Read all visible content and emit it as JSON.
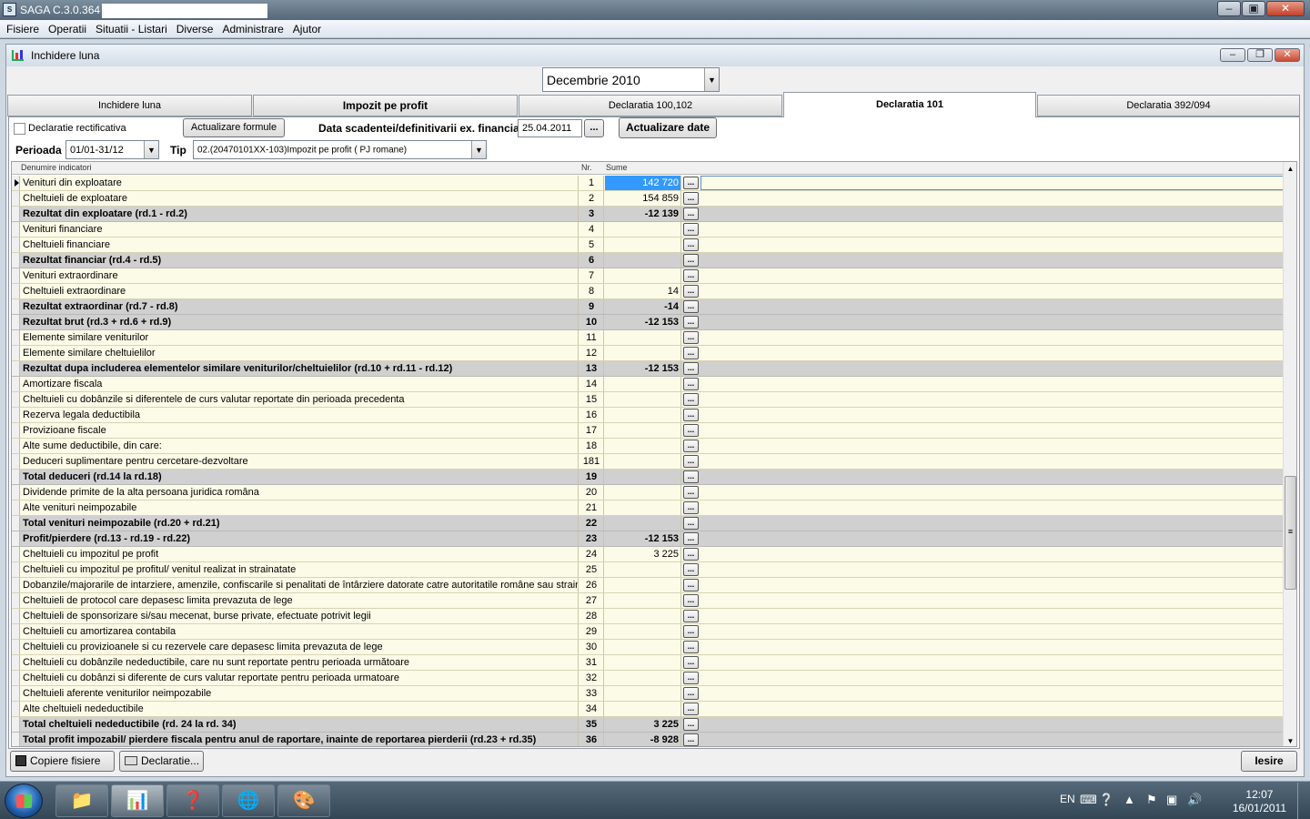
{
  "app": {
    "title": "SAGA C.3.0.364"
  },
  "menu": [
    "Fisiere",
    "Operatii",
    "Situatii - Listari",
    "Diverse",
    "Administrare",
    "Ajutor"
  ],
  "window": {
    "title": "Inchidere luna"
  },
  "period_combo": {
    "value": "Decembrie  2010"
  },
  "tabs": [
    "Inchidere luna",
    "Impozit pe profit",
    "Declaratia 100,102",
    "Declaratia 101",
    "Declaratia 392/094"
  ],
  "form": {
    "rectificativa_label": "Declaratie rectificativa",
    "rectificativa_checked": false,
    "actualizare_formule": "Actualizare formule",
    "data_scadentei_label": "Data scadentei/definitivarii ex. financiar",
    "data_scadentei_value": "25.04.2011",
    "browse_label": "...",
    "actualizare_date": "Actualizare date",
    "perioada_label": "Perioada",
    "perioada_value": "01/01-31/12",
    "tip_label": "Tip",
    "tip_value": "02.(20470101XX-103)Impozit pe profit ( PJ romane)"
  },
  "grid": {
    "headers": {
      "name": "Denumire indicatori",
      "nr": "Nr.",
      "sum": "Sume"
    },
    "rows": [
      {
        "name": "Venituri din exploatare",
        "nr": "1",
        "sum": "142 720",
        "bold": false,
        "selected": true
      },
      {
        "name": "Cheltuieli de exploatare",
        "nr": "2",
        "sum": "154 859",
        "bold": false
      },
      {
        "name": "Rezultat din exploatare (rd.1 - rd.2)",
        "nr": "3",
        "sum": "-12 139",
        "bold": true
      },
      {
        "name": "Venituri financiare",
        "nr": "4",
        "sum": "",
        "bold": false
      },
      {
        "name": "Cheltuieli financiare",
        "nr": "5",
        "sum": "",
        "bold": false
      },
      {
        "name": "Rezultat  financiar (rd.4 - rd.5)",
        "nr": "6",
        "sum": "",
        "bold": true
      },
      {
        "name": "Venituri extraordinare",
        "nr": "7",
        "sum": "",
        "bold": false
      },
      {
        "name": "Cheltuieli extraordinare",
        "nr": "8",
        "sum": "14",
        "bold": false
      },
      {
        "name": "Rezultat extraordinar (rd.7 - rd.8)",
        "nr": "9",
        "sum": "-14",
        "bold": true
      },
      {
        "name": "Rezultat brut (rd.3 + rd.6 + rd.9)",
        "nr": "10",
        "sum": "-12 153",
        "bold": true
      },
      {
        "name": "Elemente similare veniturilor",
        "nr": "11",
        "sum": "",
        "bold": false
      },
      {
        "name": "Elemente similare cheltuielilor",
        "nr": "12",
        "sum": "",
        "bold": false
      },
      {
        "name": "Rezultat dupa includerea elementelor similare veniturilor/cheltuielilor (rd.10 + rd.11 - rd.12)",
        "nr": "13",
        "sum": "-12 153",
        "bold": true
      },
      {
        "name": "Amortizare fiscala",
        "nr": "14",
        "sum": "",
        "bold": false
      },
      {
        "name": "Cheltuieli cu dobânzile si diferentele de curs valutar reportate din perioada precedenta",
        "nr": "15",
        "sum": "",
        "bold": false
      },
      {
        "name": "Rezerva legala deductibila",
        "nr": "16",
        "sum": "",
        "bold": false
      },
      {
        "name": "Provizioane fiscale",
        "nr": "17",
        "sum": "",
        "bold": false
      },
      {
        "name": "Alte sume deductibile, din care:",
        "nr": "18",
        "sum": "",
        "bold": false
      },
      {
        "name": "Deduceri suplimentare pentru cercetare-dezvoltare",
        "nr": "181",
        "sum": "",
        "bold": false
      },
      {
        "name": "Total deduceri (rd.14 la rd.18)",
        "nr": "19",
        "sum": "",
        "bold": true
      },
      {
        "name": "Dividende primite de la alta persoana juridica româna",
        "nr": "20",
        "sum": "",
        "bold": false
      },
      {
        "name": "Alte venituri neimpozabile",
        "nr": "21",
        "sum": "",
        "bold": false
      },
      {
        "name": "Total venituri neimpozabile (rd.20 + rd.21)",
        "nr": "22",
        "sum": "",
        "bold": true
      },
      {
        "name": "Profit/pierdere (rd.13 - rd.19 - rd.22)",
        "nr": "23",
        "sum": "-12 153",
        "bold": true
      },
      {
        "name": "Cheltuieli cu impozitul pe profit",
        "nr": "24",
        "sum": "3 225",
        "bold": false
      },
      {
        "name": "Cheltuieli cu impozitul pe profitul/ venitul realizat in strainatate",
        "nr": "25",
        "sum": "",
        "bold": false
      },
      {
        "name": "Dobanzile/majorarile de intarziere, amenzile, confiscarile si penalitati de întârziere datorate catre autoritatile române sau straine",
        "nr": "26",
        "sum": "",
        "bold": false
      },
      {
        "name": "Cheltuieli de protocol care depasesc limita prevazuta de lege",
        "nr": "27",
        "sum": "",
        "bold": false
      },
      {
        "name": "Cheltuieli de sponsorizare si/sau mecenat, burse private, efectuate potrivit legii",
        "nr": "28",
        "sum": "",
        "bold": false
      },
      {
        "name": "Cheltuieli cu amortizarea contabila",
        "nr": "29",
        "sum": "",
        "bold": false
      },
      {
        "name": "Cheltuieli cu  provizioanele si cu rezervele care depasesc limita prevazuta de lege",
        "nr": "30",
        "sum": "",
        "bold": false
      },
      {
        "name": "Cheltuieli cu dobânzile nedeductibile, care nu sunt reportate pentru perioada următoare",
        "nr": "31",
        "sum": "",
        "bold": false
      },
      {
        "name": "Cheltuieli cu dobânzi si diferente de curs valutar reportate pentru perioada urmatoare",
        "nr": "32",
        "sum": "",
        "bold": false
      },
      {
        "name": "Cheltuieli aferente veniturilor neimpozabile",
        "nr": "33",
        "sum": "",
        "bold": false
      },
      {
        "name": "Alte cheltuieli nedeductibile",
        "nr": "34",
        "sum": "",
        "bold": false
      },
      {
        "name": "Total cheltuieli nedeductibile (rd. 24 la rd. 34)",
        "nr": "35",
        "sum": "3 225",
        "bold": true
      },
      {
        "name": "Total profit impozabil/ pierdere fiscala pentru anul de raportare, inainte de reportarea pierderii (rd.23 + rd.35)",
        "nr": "36",
        "sum": "-8 928",
        "bold": true
      }
    ],
    "row_button": "..."
  },
  "bottom": {
    "copiere": "Copiere fisiere",
    "declaratie": "Declaratie...",
    "iesire": "Iesire"
  },
  "taskbar": {
    "lang": "EN",
    "time": "12:07",
    "date": "16/01/2011"
  }
}
